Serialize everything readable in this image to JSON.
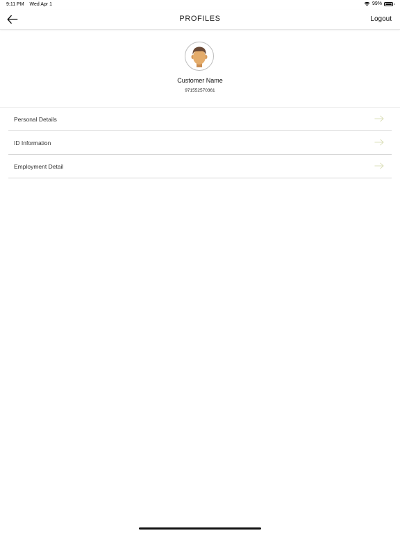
{
  "status_bar": {
    "time": "9:11 PM",
    "date": "Wed Apr 1",
    "battery_percent": "99%",
    "icons": [
      "wifi-icon",
      "battery-icon"
    ]
  },
  "nav": {
    "title": "PROFILES",
    "back_icon": "back-arrow-icon",
    "logout_label": "Logout"
  },
  "profile": {
    "avatar_icon": "user-avatar-icon",
    "name": "Customer Name",
    "phone": "971552570361"
  },
  "menu": {
    "items": [
      {
        "label": "Personal Details",
        "icon": "arrow-right-icon"
      },
      {
        "label": "ID Information",
        "icon": "arrow-right-icon"
      },
      {
        "label": "Employment Detail",
        "icon": "arrow-right-icon"
      }
    ]
  },
  "colors": {
    "arrow_accent": "#d9ddb5",
    "divider": "#d6d6d6",
    "text": "#333333"
  }
}
